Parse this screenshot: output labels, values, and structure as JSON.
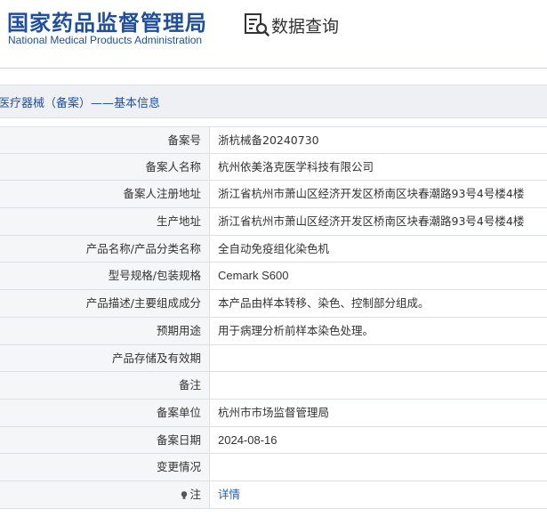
{
  "header": {
    "org_name_cn": "国家药品监督管理局",
    "org_name_en": "National Medical Products Administration",
    "query_title": "数据查询",
    "query_icon": "document-search-icon"
  },
  "section": {
    "title": "医疗器械（备案）——基本信息"
  },
  "rows": [
    {
      "label": "备案号",
      "value": "浙杭械备20240730"
    },
    {
      "label": "备案人名称",
      "value": "杭州依美洛克医学科技有限公司"
    },
    {
      "label": "备案人注册地址",
      "value": "浙江省杭州市萧山区经济开发区桥南区块春潮路93号4号楼4楼"
    },
    {
      "label": "生产地址",
      "value": "浙江省杭州市萧山区经济开发区桥南区块春潮路93号4号楼4楼"
    },
    {
      "label": "产品名称/产品分类名称",
      "value": "全自动免疫组化染色机"
    },
    {
      "label": "型号规格/包装规格",
      "value": "Cemark S600"
    },
    {
      "label": "产品描述/主要组成成分",
      "value": "本产品由样本转移、染色、控制部分组成。"
    },
    {
      "label": "预期用途",
      "value": "用于病理分析前样本染色处理。"
    },
    {
      "label": "产品存储及有效期",
      "value": ""
    },
    {
      "label": "备注",
      "value": ""
    },
    {
      "label": "备案单位",
      "value": "杭州市市场监督管理局"
    },
    {
      "label": "备案日期",
      "value": "2024-08-16"
    },
    {
      "label": "变更情况",
      "value": ""
    },
    {
      "label": "注",
      "value": "详情",
      "icon": "lightbulb-icon"
    }
  ],
  "colors": {
    "brand": "#1f4f9a",
    "link": "#1f5fae",
    "label_bg": "#f5f6f8",
    "section_bg": "#eef0f4"
  }
}
